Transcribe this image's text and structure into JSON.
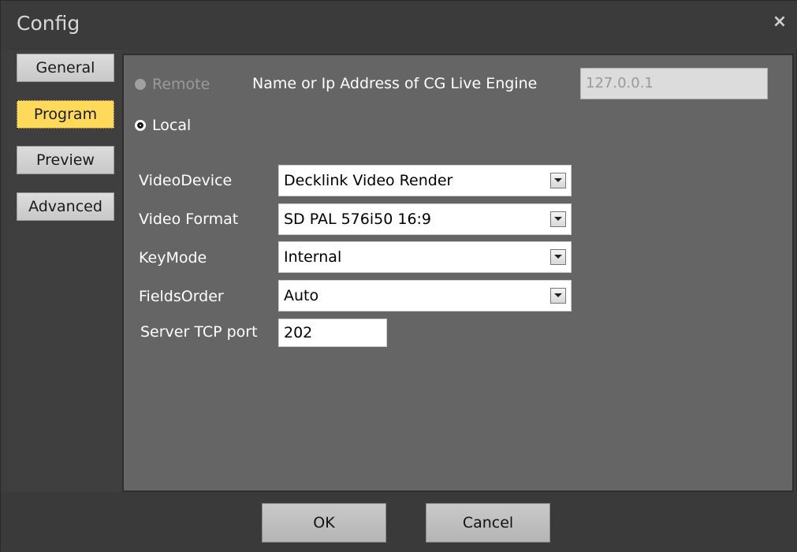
{
  "window": {
    "title": "Config",
    "close_glyph": "×"
  },
  "sidebar": {
    "tabs": [
      {
        "label": "General",
        "selected": false
      },
      {
        "label": "Program",
        "selected": true
      },
      {
        "label": "Preview",
        "selected": false
      },
      {
        "label": "Advanced",
        "selected": false
      }
    ]
  },
  "connection": {
    "remote_label": "Remote",
    "remote_enabled": false,
    "local_label": "Local",
    "local_checked": true,
    "engine_address_label": "Name or Ip Address of CG Live Engine",
    "engine_address_value": "127.0.0.1"
  },
  "fields": {
    "video_device": {
      "label": "VideoDevice",
      "value": "Decklink Video Render"
    },
    "video_format": {
      "label": "Video Format",
      "value": "SD PAL 576i50 16:9"
    },
    "key_mode": {
      "label": "KeyMode",
      "value": "Internal"
    },
    "fields_order": {
      "label": "FieldsOrder",
      "value": "Auto"
    },
    "server_tcp_port": {
      "label": "Server TCP port",
      "value": "202"
    }
  },
  "footer": {
    "ok_label": "OK",
    "cancel_label": "Cancel"
  },
  "colors": {
    "selected_tab": "#ffd95a",
    "content_bg": "#656565",
    "window_bg": "#3d3d3d"
  }
}
